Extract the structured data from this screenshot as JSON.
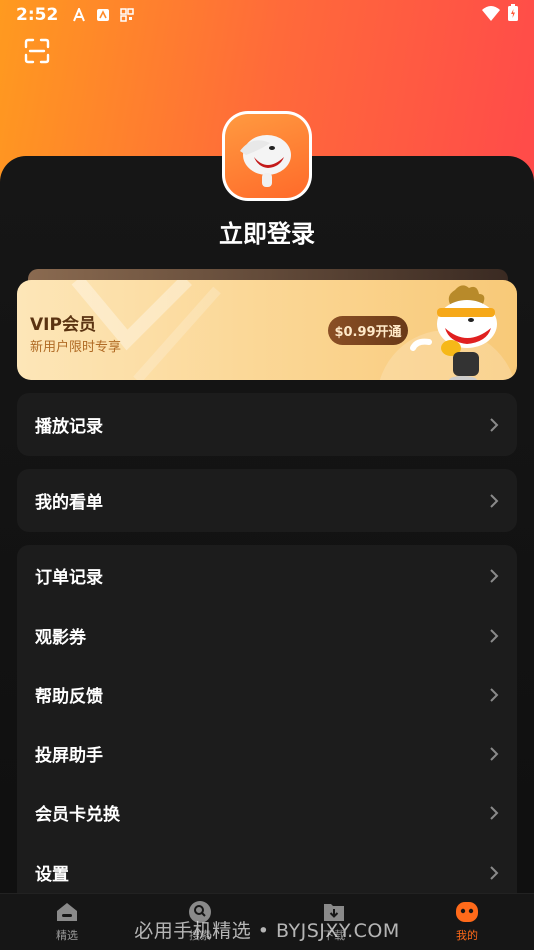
{
  "status_bar": {
    "time": "2:52"
  },
  "profile": {
    "login_label": "立即登录"
  },
  "vip": {
    "title": "VIP会员",
    "subtitle": "新用户限时专享",
    "button": "$0.99开通"
  },
  "menu_group_1": [
    {
      "label": "播放记录"
    }
  ],
  "menu_group_2": [
    {
      "label": "我的看单"
    }
  ],
  "menu_group_3": [
    {
      "label": "订单记录"
    },
    {
      "label": "观影券"
    },
    {
      "label": "帮助反馈"
    },
    {
      "label": "投屏助手"
    },
    {
      "label": "会员卡兑换"
    },
    {
      "label": "设置"
    }
  ],
  "tabs": [
    {
      "label": "精选",
      "icon": "home-icon"
    },
    {
      "label": "搜索",
      "icon": "search-icon"
    },
    {
      "label": "下载",
      "icon": "download-icon"
    },
    {
      "label": "我的",
      "icon": "profile-icon",
      "active": true
    }
  ],
  "watermark": "必用手机精选 • BYJSJXY.COM",
  "colors": {
    "accent": "#ff6a1a",
    "hero_start": "#ff9a1f",
    "hero_end": "#ff4a4a",
    "vip_gold": "#fbd898"
  }
}
